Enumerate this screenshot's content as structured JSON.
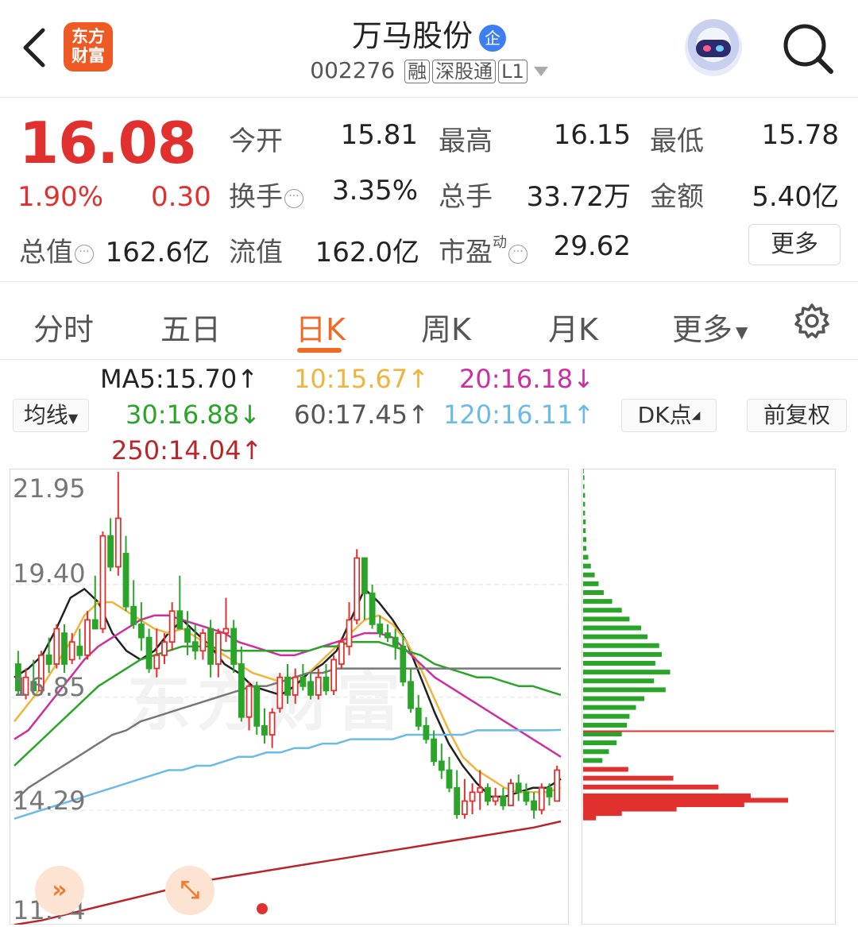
{
  "header": {
    "app_logo_line1": "东方",
    "app_logo_line2": "财富",
    "stock_name": "万马股份",
    "badge": "企",
    "code": "002276",
    "tags": [
      "融",
      "深股通",
      "L1"
    ]
  },
  "quote": {
    "price": "16.08",
    "change_pct": "1.90%",
    "change": "0.30",
    "open_label": "今开",
    "open": "15.81",
    "high_label": "最高",
    "high": "16.15",
    "low_label": "最低",
    "low": "15.78",
    "turnover_label": "换手",
    "turnover": "3.35%",
    "volume_label": "总手",
    "volume": "33.72万",
    "amount_label": "金额",
    "amount": "5.40亿",
    "mktcap_label": "总值",
    "mktcap": "162.6亿",
    "float_label": "流值",
    "float": "162.0亿",
    "pe_label": "市盈",
    "pe_sup": "动",
    "pe": "29.62",
    "more": "更多"
  },
  "tabs": [
    {
      "label": "分时"
    },
    {
      "label": "五日"
    },
    {
      "label": "日K",
      "active": true
    },
    {
      "label": "周K"
    },
    {
      "label": "月K"
    },
    {
      "label": "更多"
    }
  ],
  "ma_legend": {
    "selector": "均线",
    "ma5": "MA5:15.70↑",
    "ma10": "10:15.67↑",
    "ma20": "20:16.18↓",
    "ma30": "30:16.88↓",
    "ma60": "60:17.45↑",
    "ma120": "120:16.11↑",
    "ma250": "250:14.04↑",
    "dk_button": "DK点",
    "adjust_button": "前复权"
  },
  "colors": {
    "up": "#e0312f",
    "down": "#2aa52a",
    "ma5": "#222222",
    "ma10": "#f0b43c",
    "ma20": "#cc2fa0",
    "ma30": "#2aa52a",
    "ma60": "#777777",
    "ma120": "#6cbbe6",
    "ma250": "#b8262c"
  },
  "chart_data": {
    "type": "candlestick",
    "y_ticks": [
      "21.95",
      "19.40",
      "16.85",
      "14.29",
      "11.74"
    ],
    "ylim": [
      11.74,
      21.95
    ],
    "watermark": "东方财富",
    "candles": [
      [
        17.6,
        17.9,
        16.9,
        17.0
      ],
      [
        16.9,
        17.5,
        16.8,
        17.3
      ],
      [
        17.2,
        17.7,
        16.9,
        17.0
      ],
      [
        17.0,
        17.9,
        16.9,
        17.8
      ],
      [
        17.8,
        18.2,
        17.4,
        17.6
      ],
      [
        17.6,
        18.5,
        17.5,
        18.4
      ],
      [
        18.3,
        18.5,
        17.4,
        17.6
      ],
      [
        17.7,
        18.3,
        17.6,
        18.1
      ],
      [
        18.0,
        18.4,
        17.7,
        17.8
      ],
      [
        17.8,
        18.8,
        17.7,
        18.6
      ],
      [
        18.6,
        19.6,
        18.4,
        18.4
      ],
      [
        18.4,
        20.6,
        18.3,
        20.5
      ],
      [
        20.5,
        20.9,
        19.7,
        19.8
      ],
      [
        19.8,
        21.95,
        19.6,
        20.9
      ],
      [
        20.1,
        20.5,
        18.8,
        18.9
      ],
      [
        18.9,
        19.5,
        18.4,
        18.5
      ],
      [
        18.5,
        19.0,
        17.9,
        18.2
      ],
      [
        18.2,
        18.4,
        17.4,
        17.5
      ],
      [
        17.5,
        18.4,
        17.3,
        17.8
      ],
      [
        17.8,
        18.3,
        17.6,
        18.1
      ],
      [
        18.1,
        19.0,
        17.9,
        18.8
      ],
      [
        18.8,
        19.6,
        18.6,
        18.4
      ],
      [
        18.4,
        18.8,
        17.8,
        18.1
      ],
      [
        18.1,
        18.5,
        17.7,
        17.9
      ],
      [
        17.9,
        18.4,
        17.7,
        18.3
      ],
      [
        18.4,
        18.6,
        17.3,
        17.6
      ],
      [
        17.6,
        18.4,
        17.3,
        18.3
      ],
      [
        18.3,
        19.1,
        18.1,
        18.4
      ],
      [
        18.4,
        18.6,
        17.4,
        17.6
      ],
      [
        17.6,
        18.0,
        16.3,
        16.4
      ],
      [
        16.4,
        17.2,
        16.1,
        17.1
      ],
      [
        17.1,
        17.2,
        16.0,
        16.2
      ],
      [
        16.2,
        16.6,
        15.8,
        16.0
      ],
      [
        16.0,
        16.6,
        15.7,
        16.5
      ],
      [
        16.6,
        17.4,
        16.5,
        17.3
      ],
      [
        17.3,
        17.6,
        16.7,
        16.9
      ],
      [
        16.9,
        17.5,
        16.7,
        17.3
      ],
      [
        17.3,
        17.6,
        17.0,
        17.1
      ],
      [
        17.2,
        17.4,
        16.8,
        16.9
      ],
      [
        16.9,
        17.5,
        16.8,
        17.3
      ],
      [
        17.3,
        17.6,
        16.9,
        17.0
      ],
      [
        17.0,
        17.8,
        16.9,
        17.7
      ],
      [
        17.6,
        18.2,
        17.5,
        18.1
      ],
      [
        18.0,
        19.0,
        17.8,
        18.6
      ],
      [
        18.6,
        20.2,
        18.5,
        20.0
      ],
      [
        20.0,
        20.0,
        18.6,
        19.2
      ],
      [
        19.2,
        19.4,
        18.4,
        18.5
      ],
      [
        18.5,
        18.7,
        18.2,
        18.3
      ],
      [
        18.3,
        18.5,
        18.1,
        18.2
      ],
      [
        18.2,
        18.4,
        17.7,
        18.0
      ],
      [
        18.0,
        18.3,
        17.1,
        17.2
      ],
      [
        17.2,
        17.5,
        16.5,
        16.6
      ],
      [
        16.6,
        16.9,
        16.1,
        16.2
      ],
      [
        16.2,
        16.4,
        15.8,
        15.9
      ],
      [
        15.9,
        16.1,
        15.3,
        15.4
      ],
      [
        15.4,
        15.8,
        15.0,
        15.2
      ],
      [
        15.2,
        15.5,
        14.7,
        14.8
      ],
      [
        14.8,
        15.2,
        14.1,
        14.2
      ],
      [
        14.2,
        15.0,
        14.1,
        14.5
      ],
      [
        14.5,
        14.9,
        14.2,
        14.7
      ],
      [
        14.7,
        15.2,
        14.3,
        14.8
      ],
      [
        14.8,
        14.9,
        14.4,
        14.5
      ],
      [
        14.5,
        14.8,
        14.4,
        14.6
      ],
      [
        14.6,
        14.8,
        14.3,
        14.4
      ],
      [
        14.4,
        15.0,
        14.4,
        14.9
      ],
      [
        14.9,
        15.1,
        14.5,
        14.7
      ],
      [
        14.7,
        14.9,
        14.4,
        14.5
      ],
      [
        14.5,
        14.7,
        14.1,
        14.3
      ],
      [
        14.3,
        14.9,
        14.2,
        14.8
      ],
      [
        14.8,
        14.9,
        14.4,
        14.6
      ],
      [
        14.5,
        15.3,
        14.5,
        15.2
      ]
    ],
    "ma_series": [
      {
        "name": "MA5",
        "color": "#222222",
        "values": [
          17.3,
          17.5,
          17.8,
          18.4,
          19.1,
          19.3,
          19.0,
          18.3,
          17.9,
          17.7,
          17.9,
          18.3,
          18.6,
          18.3,
          18.0,
          17.6,
          17.4,
          17.1,
          17.0,
          16.9,
          17.1,
          17.4,
          17.6,
          17.9,
          18.6,
          19.3,
          19.0,
          18.6,
          18.1,
          17.3,
          16.5,
          15.8,
          15.3,
          14.9,
          14.6,
          14.6,
          14.7,
          14.8,
          14.8,
          15.0
        ]
      },
      {
        "name": "MA10",
        "color": "#f0b43c",
        "values": [
          16.3,
          16.7,
          17.1,
          17.6,
          18.1,
          18.7,
          19.0,
          19.0,
          18.8,
          18.6,
          18.4,
          18.3,
          18.4,
          18.2,
          18.0,
          17.8,
          17.6,
          17.4,
          17.3,
          17.2,
          17.3,
          17.4,
          17.7,
          18.0,
          18.3,
          18.6,
          18.7,
          18.5,
          18.1,
          17.5,
          16.8,
          16.1,
          15.5,
          15.2,
          15.0,
          14.8,
          14.7,
          14.7,
          14.7,
          14.8
        ]
      },
      {
        "name": "MA20",
        "color": "#cc2fa0",
        "values": [
          15.9,
          16.1,
          16.5,
          16.9,
          17.3,
          17.7,
          18.0,
          18.2,
          18.4,
          18.6,
          18.7,
          18.7,
          18.6,
          18.5,
          18.4,
          18.3,
          18.1,
          18.0,
          17.9,
          17.8,
          17.8,
          17.9,
          18.0,
          18.1,
          18.2,
          18.3,
          18.3,
          18.2,
          17.9,
          17.6,
          17.3,
          17.1,
          16.9,
          16.7,
          16.5,
          16.3,
          16.1,
          15.9,
          15.7,
          15.5
        ]
      },
      {
        "name": "MA30",
        "color": "#2aa52a",
        "values": [
          15.3,
          15.6,
          15.9,
          16.2,
          16.5,
          16.8,
          17.1,
          17.3,
          17.5,
          17.7,
          17.8,
          17.9,
          18.0,
          18.0,
          18.0,
          17.9,
          17.9,
          17.9,
          17.9,
          17.9,
          17.9,
          17.9,
          18.0,
          18.0,
          18.1,
          18.1,
          18.1,
          18.0,
          17.9,
          17.8,
          17.6,
          17.5,
          17.4,
          17.3,
          17.3,
          17.2,
          17.1,
          17.1,
          17.0,
          16.9
        ]
      },
      {
        "name": "MA60",
        "color": "#777777",
        "values": [
          14.5,
          14.8,
          15.0,
          15.2,
          15.4,
          15.6,
          15.8,
          16.0,
          16.1,
          16.3,
          16.4,
          16.5,
          16.6,
          16.7,
          16.8,
          16.9,
          17.0,
          17.1,
          17.1,
          17.2,
          17.3,
          17.4,
          17.4,
          17.5,
          17.5,
          17.5,
          17.5,
          17.5,
          17.5,
          17.5,
          17.5,
          17.5,
          17.5,
          17.5,
          17.5,
          17.5,
          17.5,
          17.5,
          17.5,
          17.5
        ]
      },
      {
        "name": "MA120",
        "color": "#6cbbe6",
        "values": [
          14.1,
          14.2,
          14.3,
          14.4,
          14.5,
          14.6,
          14.7,
          14.8,
          14.9,
          15.0,
          15.1,
          15.2,
          15.2,
          15.3,
          15.3,
          15.4,
          15.5,
          15.5,
          15.6,
          15.6,
          15.7,
          15.7,
          15.8,
          15.8,
          15.9,
          15.9,
          15.9,
          15.9,
          16.0,
          16.0,
          16.0,
          16.0,
          16.0,
          16.1,
          16.1,
          16.1,
          16.1,
          16.1,
          16.1,
          16.11
        ]
      },
      {
        "name": "MA250",
        "color": "#b8262c",
        "values": [
          11.7,
          11.8,
          11.95,
          12.1,
          12.25,
          12.4,
          12.55,
          12.7,
          12.8,
          12.9,
          13.0,
          13.1,
          13.2,
          13.3,
          13.4,
          13.5,
          13.6,
          13.7,
          13.8,
          13.9,
          14.04
        ]
      }
    ],
    "volume_profile": {
      "current_price": 16.08,
      "bins": [
        {
          "price": 21.95,
          "v": 1
        },
        {
          "price": 21.8,
          "v": 2
        },
        {
          "price": 21.6,
          "v": 2
        },
        {
          "price": 21.4,
          "v": 3
        },
        {
          "price": 21.2,
          "v": 3
        },
        {
          "price": 21.0,
          "v": 3
        },
        {
          "price": 20.8,
          "v": 4
        },
        {
          "price": 20.6,
          "v": 4
        },
        {
          "price": 20.4,
          "v": 5
        },
        {
          "price": 20.2,
          "v": 5
        },
        {
          "price": 20.0,
          "v": 8
        },
        {
          "price": 19.8,
          "v": 12
        },
        {
          "price": 19.6,
          "v": 18
        },
        {
          "price": 19.4,
          "v": 24
        },
        {
          "price": 19.2,
          "v": 32
        },
        {
          "price": 19.0,
          "v": 45
        },
        {
          "price": 18.8,
          "v": 60
        },
        {
          "price": 18.6,
          "v": 72
        },
        {
          "price": 18.4,
          "v": 90
        },
        {
          "price": 18.2,
          "v": 100
        },
        {
          "price": 18.0,
          "v": 118
        },
        {
          "price": 17.8,
          "v": 122
        },
        {
          "price": 17.6,
          "v": 112
        },
        {
          "price": 17.4,
          "v": 135
        },
        {
          "price": 17.2,
          "v": 110
        },
        {
          "price": 17.0,
          "v": 128
        },
        {
          "price": 16.8,
          "v": 95
        },
        {
          "price": 16.6,
          "v": 82
        },
        {
          "price": 16.4,
          "v": 72
        },
        {
          "price": 16.2,
          "v": 68
        },
        {
          "price": 16.0,
          "v": 60
        },
        {
          "price": 15.8,
          "v": 52
        },
        {
          "price": 15.6,
          "v": 40
        },
        {
          "price": 15.4,
          "v": 30
        },
        {
          "price": 15.2,
          "v": 70,
          "up": true
        },
        {
          "price": 15.0,
          "v": 140,
          "up": true
        },
        {
          "price": 14.8,
          "v": 210,
          "up": true
        },
        {
          "price": 14.6,
          "v": 260,
          "up": true
        },
        {
          "price": 14.5,
          "v": 318,
          "up": true
        },
        {
          "price": 14.4,
          "v": 250,
          "up": true
        },
        {
          "price": 14.3,
          "v": 145,
          "up": true
        },
        {
          "price": 14.2,
          "v": 60,
          "up": true
        },
        {
          "price": 14.1,
          "v": 20,
          "up": true
        }
      ]
    }
  }
}
